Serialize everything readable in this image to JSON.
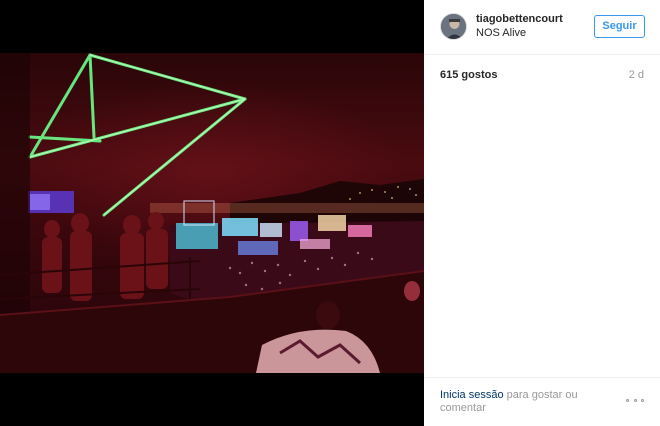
{
  "post": {
    "username": "tiagobettencourt",
    "location": "NOS Alive",
    "follow_label": "Seguir",
    "likes": "615 gostos",
    "time_ago": "2 d",
    "login_link": "Inicia sessão",
    "login_suffix": " para gostar ou comentar",
    "photo_alt": "tiagobettencourt post photo"
  },
  "icons": {
    "avatar": "user-avatar",
    "more": "more-options-icon"
  },
  "colors": {
    "accent": "#3897f0",
    "link": "#003569",
    "muted": "#999999",
    "text": "#262626"
  }
}
